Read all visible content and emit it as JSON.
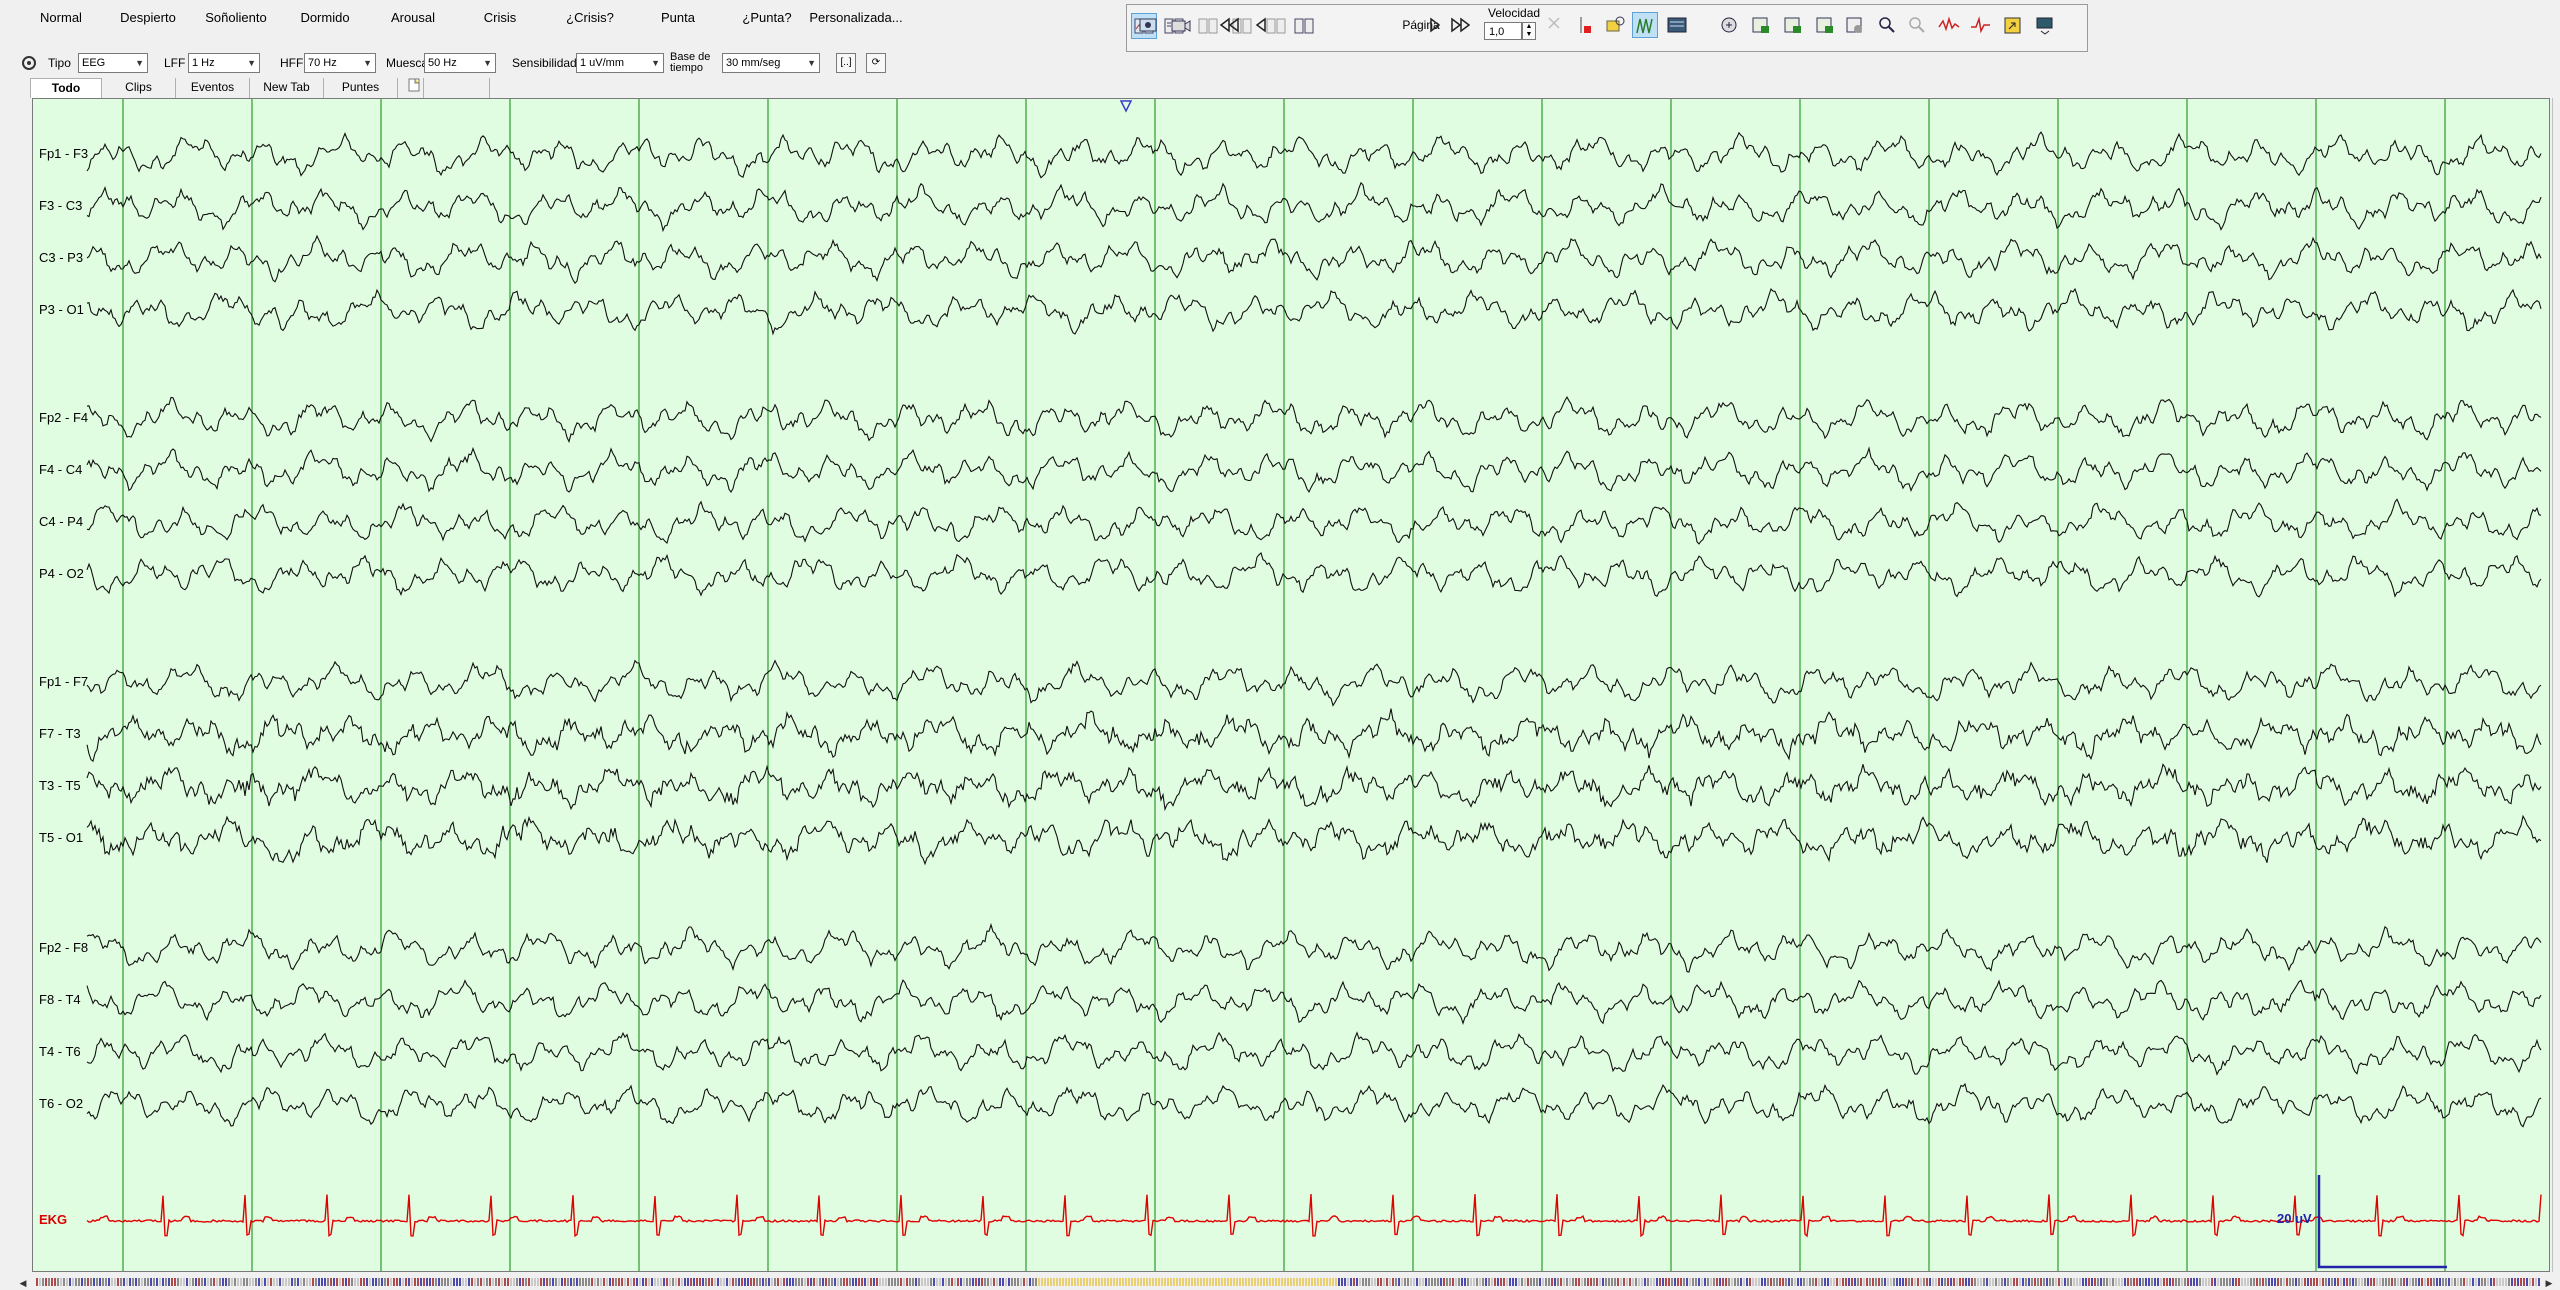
{
  "event_buttons": [
    {
      "label": "Normal"
    },
    {
      "label": "Despierto"
    },
    {
      "label": "Soñoliento"
    },
    {
      "label": "Dormido"
    },
    {
      "label": "Arousal"
    },
    {
      "label": "Crisis"
    },
    {
      "label": "¿Crisis?"
    },
    {
      "label": "Punta"
    },
    {
      "label": "¿Punta?"
    },
    {
      "label": "Personalizada..."
    }
  ],
  "toolbar": {
    "page_select": "Página",
    "speed_label": "Velocidad",
    "speed_value": "1,0",
    "icons": [
      "layout-1-icon",
      "layout-2-icon",
      "layout-3-icon",
      "layout-4-icon",
      "layout-5-icon",
      "layout-6-icon",
      "record-icon",
      "camera-icon",
      "rewind-icon",
      "step-back-icon",
      "step-forward-icon",
      "fast-forward-icon",
      "cursor-disabled-icon",
      "marker-icon",
      "electrode-icon",
      "montage-icon",
      "display-icon",
      "annotate-icon",
      "report-1-icon",
      "report-2-icon",
      "report-3-icon",
      "report-4-icon",
      "zoom-in-icon",
      "zoom-out-icon",
      "waveform-icon",
      "spike-icon",
      "export-icon",
      "settings-icon"
    ]
  },
  "filters": {
    "tipo_label": "Tipo",
    "tipo_value": "EEG",
    "lff_label": "LFF",
    "lff_value": "1 Hz",
    "hff_label": "HFF",
    "hff_value": "70 Hz",
    "muesca_label": "Muesca",
    "muesca_value": "50 Hz",
    "sens_label": "Sensibilidad",
    "sens_value": "1 uV/mm",
    "base_label_1": "Base de",
    "base_label_2": "tiempo",
    "base_value": "30 mm/seg",
    "btn1": "[..]",
    "btn2": "⟳"
  },
  "tabs": [
    {
      "label": "Todo",
      "active": true
    },
    {
      "label": "Clips"
    },
    {
      "label": "Eventos"
    },
    {
      "label": "New Tab"
    },
    {
      "label": "Puntes"
    }
  ],
  "channels": [
    {
      "label": "Fp1 - F3"
    },
    {
      "label": "F3 - C3"
    },
    {
      "label": "C3 - P3"
    },
    {
      "label": "P3 - O1"
    },
    {
      "label": "Fp2 - F4"
    },
    {
      "label": "F4 - C4"
    },
    {
      "label": "C4 - P4"
    },
    {
      "label": "P4 - O2"
    },
    {
      "label": "Fp1 - F7"
    },
    {
      "label": "F7 - T3"
    },
    {
      "label": "T3 - T5"
    },
    {
      "label": "T5 - O1"
    },
    {
      "label": "Fp2 - F8"
    },
    {
      "label": "F8 - T4"
    },
    {
      "label": "T4 - T6"
    },
    {
      "label": "T6 - O2"
    },
    {
      "label": "EKG",
      "color": "#dd0000"
    }
  ],
  "scale_label": "20 uV",
  "colors": {
    "background": "#e1fde1",
    "gridline": "#2c9a2c",
    "trace": "#111111",
    "ekg": "#e00000",
    "scale": "#2222aa"
  }
}
